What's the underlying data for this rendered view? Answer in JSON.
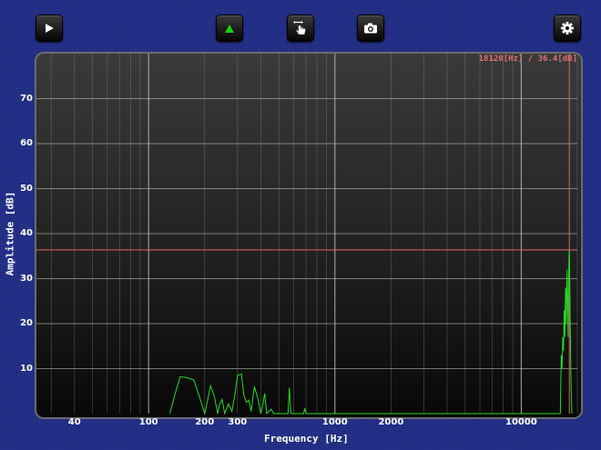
{
  "toolbar": {
    "buttons": [
      {
        "name": "play-button",
        "icon": "play-icon"
      },
      {
        "name": "peak-marker-button",
        "icon": "green-triangle-icon",
        "color": "#19d219"
      },
      {
        "name": "cursor-mode-button",
        "icon": "hand-pointer-icon"
      },
      {
        "name": "snapshot-button",
        "icon": "camera-icon"
      },
      {
        "name": "settings-button",
        "icon": "gear-icon"
      }
    ]
  },
  "cursor_readout": "18120[Hz] / 36.4[dB]",
  "chart_data": {
    "type": "line",
    "xlabel": "Frequency [Hz]",
    "ylabel": "Amplitude [dB]",
    "x_scale": "log",
    "xlim": [
      25,
      20000
    ],
    "ylim": [
      0,
      80
    ],
    "x_ticks": [
      40,
      100,
      200,
      300,
      1000,
      2000,
      10000
    ],
    "x_tick_labels": [
      "40",
      "100",
      "200",
      "300",
      "1000",
      "2000",
      "10000"
    ],
    "y_ticks": [
      10,
      20,
      30,
      40,
      50,
      60,
      70
    ],
    "y_tick_labels": [
      "10",
      "20",
      "30",
      "40",
      "50",
      "60",
      "70"
    ],
    "grid": true,
    "cursor": {
      "x": 18120,
      "y": 36.4
    },
    "series": [
      {
        "color": "#22dd22",
        "points": [
          [
            130,
            0
          ],
          [
            140,
            5
          ],
          [
            148,
            8.2
          ],
          [
            160,
            8.0
          ],
          [
            175,
            7.5
          ],
          [
            190,
            3
          ],
          [
            200,
            0
          ],
          [
            205,
            2
          ],
          [
            215,
            6.2
          ],
          [
            225,
            4
          ],
          [
            235,
            0
          ],
          [
            240,
            2
          ],
          [
            248,
            3.2
          ],
          [
            256,
            0
          ],
          [
            268,
            2.2
          ],
          [
            280,
            0.5
          ],
          [
            290,
            4
          ],
          [
            300,
            8.5
          ],
          [
            315,
            8.8
          ],
          [
            325,
            4
          ],
          [
            335,
            2.5
          ],
          [
            345,
            3
          ],
          [
            355,
            0.5
          ],
          [
            370,
            6
          ],
          [
            385,
            3.5
          ],
          [
            400,
            0
          ],
          [
            410,
            2
          ],
          [
            420,
            4.5
          ],
          [
            430,
            0
          ],
          [
            455,
            1
          ],
          [
            470,
            0
          ],
          [
            560,
            0
          ],
          [
            570,
            5.8
          ],
          [
            580,
            0
          ],
          [
            680,
            0
          ],
          [
            690,
            1.2
          ],
          [
            700,
            0
          ],
          [
            16200,
            0
          ],
          [
            16300,
            6
          ],
          [
            16400,
            13
          ],
          [
            16550,
            10
          ],
          [
            16700,
            17
          ],
          [
            16850,
            14
          ],
          [
            17000,
            23
          ],
          [
            17150,
            17
          ],
          [
            17300,
            28
          ],
          [
            17450,
            20
          ],
          [
            17600,
            32
          ],
          [
            17750,
            24
          ],
          [
            17850,
            17
          ],
          [
            17950,
            30
          ],
          [
            18050,
            35
          ],
          [
            18120,
            36.4
          ],
          [
            18200,
            31
          ],
          [
            18300,
            22
          ],
          [
            18400,
            13
          ],
          [
            18500,
            7
          ],
          [
            18600,
            3
          ],
          [
            18700,
            0
          ]
        ]
      }
    ]
  }
}
